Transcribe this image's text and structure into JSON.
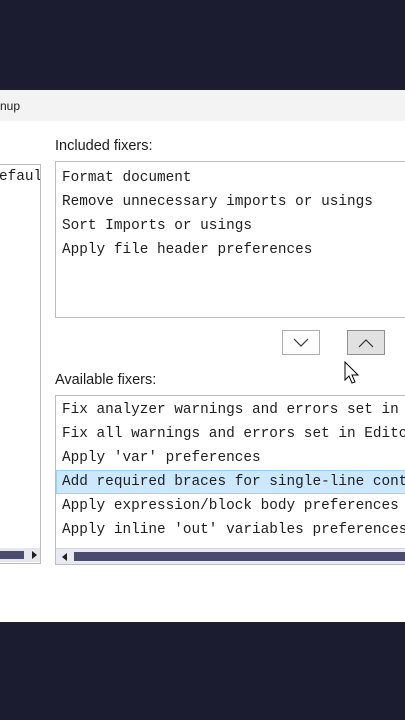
{
  "window": {
    "title": "nup"
  },
  "left_list": {
    "items": [
      "efault"
    ]
  },
  "included": {
    "label": "Included fixers:",
    "items": [
      "Format document",
      "Remove unnecessary imports or usings",
      "Sort Imports or usings",
      "Apply file header preferences"
    ]
  },
  "buttons": {
    "move_down_icon": "chevron-down-icon",
    "move_up_icon": "chevron-up-icon"
  },
  "available": {
    "label": "Available fixers:",
    "items": [
      "Fix analyzer warnings and errors set in",
      "Fix all warnings and errors set in Edito",
      "Apply 'var' preferences",
      "Add required braces for single-line cont",
      "Apply expression/block body preferences",
      "Apply inline 'out' variables preferences"
    ],
    "selected_index": 3
  },
  "colors": {
    "backdrop": "#1c1c30",
    "selection": "#cce8ff",
    "scroll_thumb": "#4b4b6d"
  }
}
